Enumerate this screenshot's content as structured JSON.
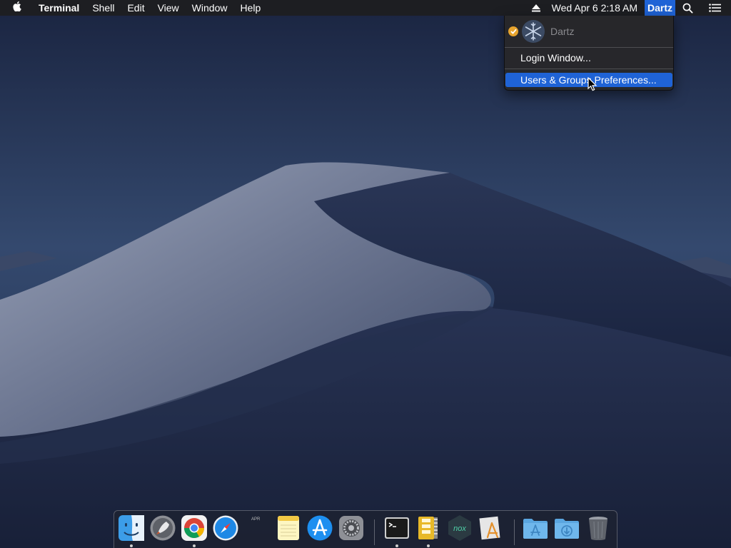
{
  "menubar": {
    "apple_icon": "apple-logo-icon",
    "app_name": "Terminal",
    "menus": [
      "Shell",
      "Edit",
      "View",
      "Window",
      "Help"
    ],
    "eject_icon": "eject-icon",
    "datetime": "Wed Apr 6  2:18 AM",
    "user": "Dartz",
    "spotlight_icon": "spotlight-search-icon",
    "notification_icon": "notification-center-icon"
  },
  "user_menu": {
    "current_user": "Dartz",
    "items": [
      "Login Window...",
      "Users & Groups Preferences..."
    ],
    "highlighted_index": 1
  },
  "dock": {
    "apps": [
      {
        "name": "Finder",
        "running": true
      },
      {
        "name": "Launchpad",
        "running": false
      },
      {
        "name": "Google Chrome",
        "running": true
      },
      {
        "name": "Safari",
        "running": false
      },
      {
        "name": "Calendar",
        "running": false,
        "badge": "APR"
      },
      {
        "name": "Notes",
        "running": false
      },
      {
        "name": "App Store",
        "running": false
      },
      {
        "name": "System Preferences",
        "running": false
      },
      {
        "name": "Terminal",
        "running": true
      },
      {
        "name": "Archive Utility",
        "running": true
      },
      {
        "name": "Nox",
        "running": false
      },
      {
        "name": "Instruments",
        "running": false
      }
    ],
    "folders": [
      "Applications",
      "Downloads"
    ],
    "trash": "Trash"
  },
  "colors": {
    "menu_highlight": "#1f63d6",
    "menubar_bg": "#1e1e20",
    "check_badge": "#e6a32d"
  }
}
